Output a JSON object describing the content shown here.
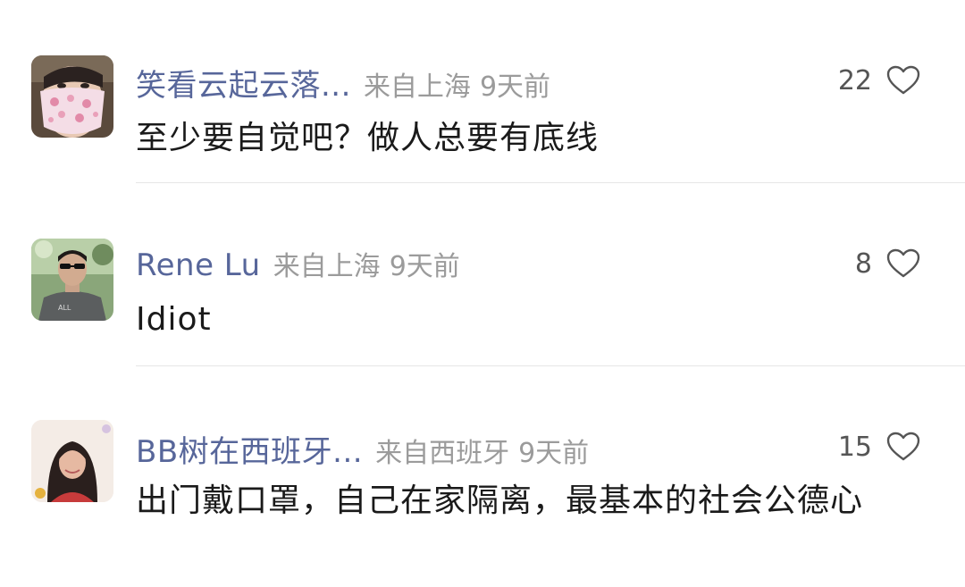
{
  "comments": [
    {
      "username": "笑看云起云落...",
      "location": "来自上海",
      "time": "9天前",
      "likes": "22",
      "text": "至少要自觉吧？做人总要有底线",
      "avatar_icon": "avatar-masked-woman"
    },
    {
      "username": "Rene Lu",
      "location": "来自上海",
      "time": "9天前",
      "likes": "8",
      "text": "Idiot",
      "avatar_icon": "avatar-man-sunglasses"
    },
    {
      "username": "BB树在西班牙...",
      "location": "来自西班牙",
      "time": "9天前",
      "likes": "15",
      "text": "出门戴口罩，自己在家隔离，最基本的社会公德心",
      "avatar_icon": "avatar-woman-smiling"
    }
  ],
  "colors": {
    "username": "#57669a",
    "meta": "#9b9b9b",
    "text": "#1a1a1a",
    "divider": "#e6e6e6"
  }
}
